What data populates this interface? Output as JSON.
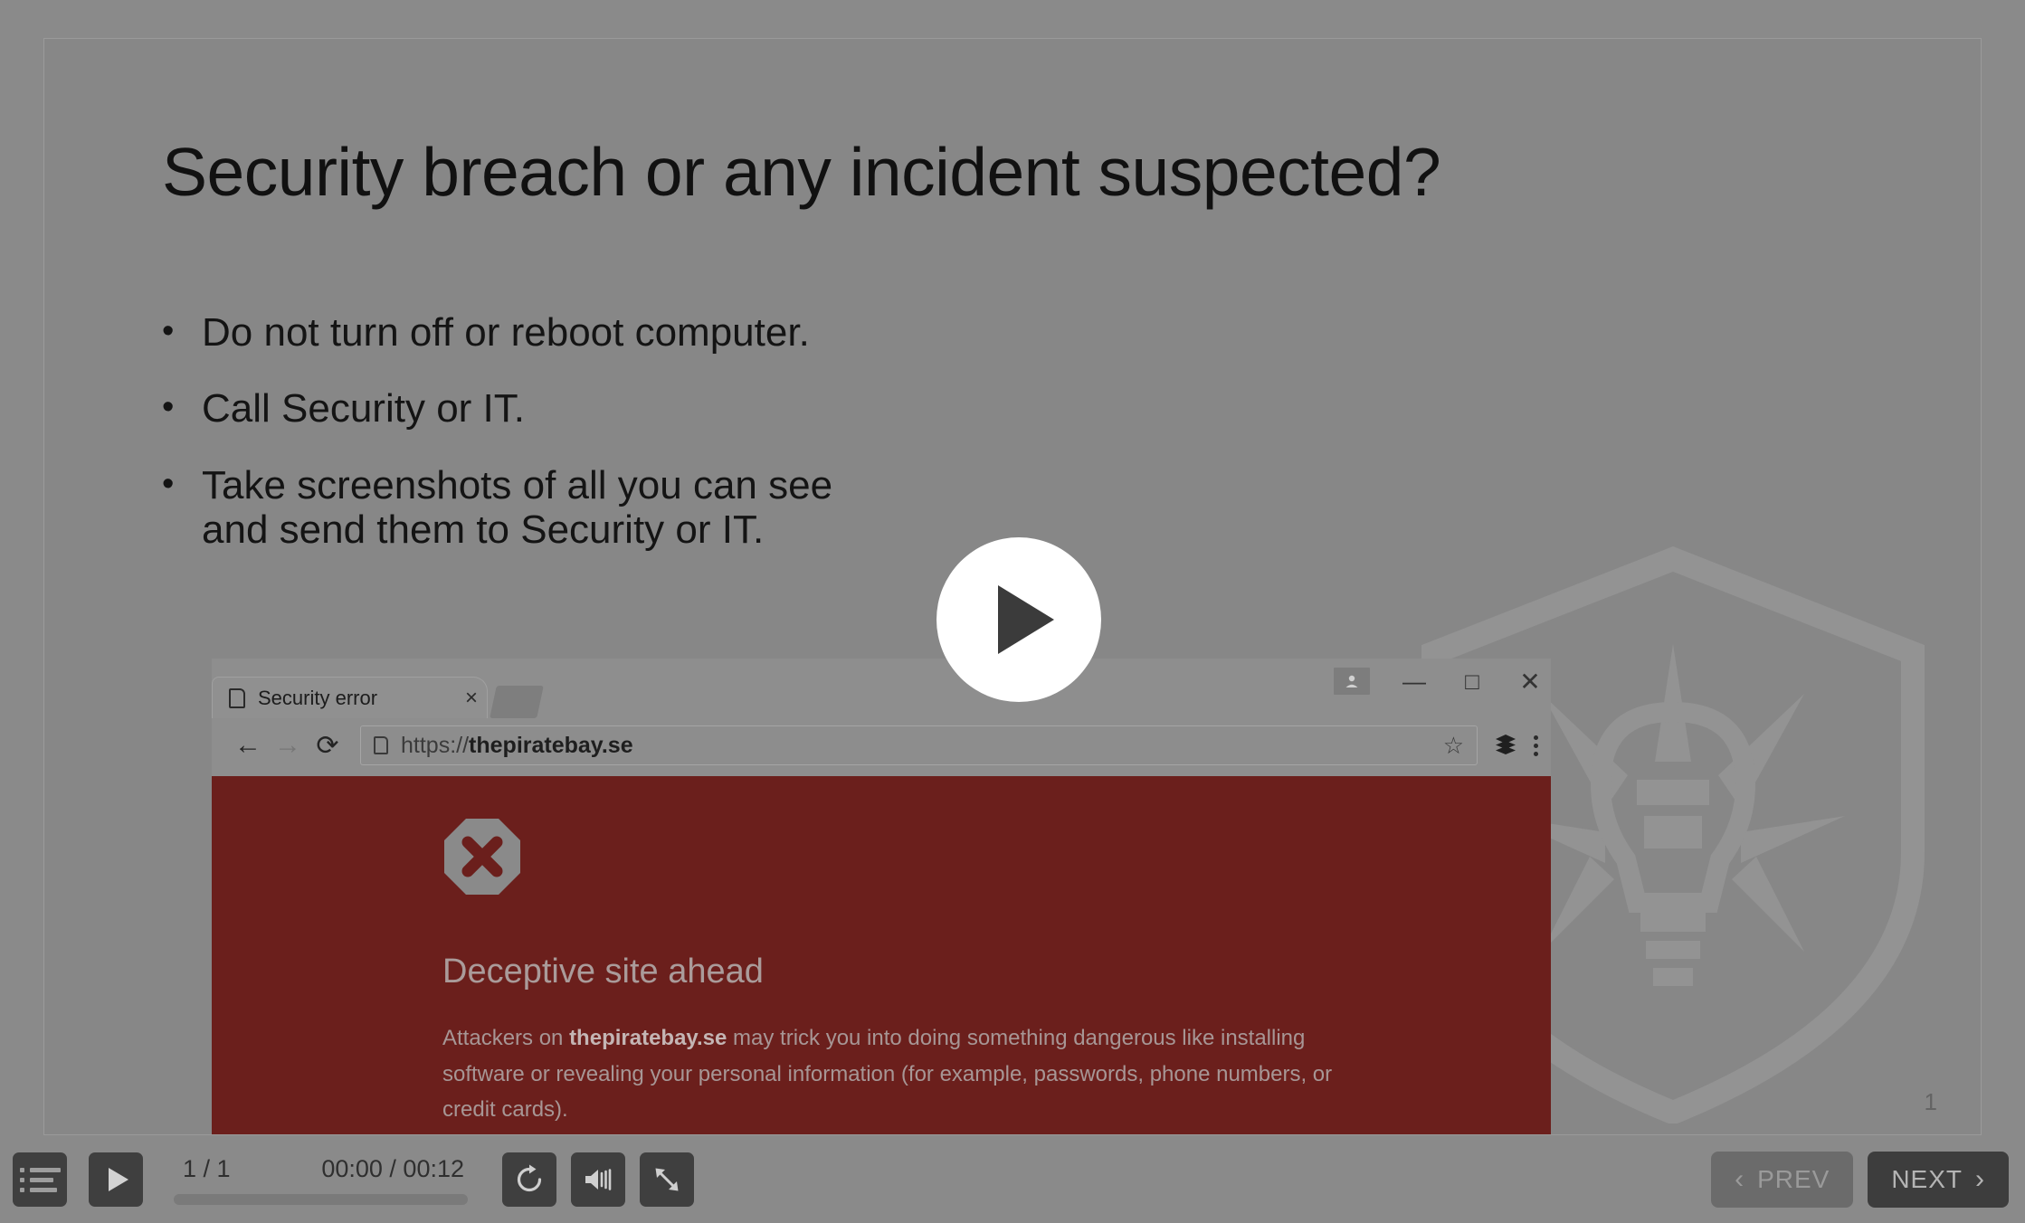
{
  "slide": {
    "title": "Security breach or any incident suspected?",
    "bullets": [
      "Do not turn off or reboot computer.",
      "Call Security or IT.",
      "Take screenshots of all you can see\nand send them to Security or IT."
    ],
    "bullet_marker": "•",
    "slide_number": "1"
  },
  "browser": {
    "tab_title": "Security error",
    "tab_close_label": "×",
    "back_label": "←",
    "forward_label": "→",
    "reload_label": "⟳",
    "url_scheme": "https://",
    "url_host": "thepiratebay.se",
    "star_label": "☆",
    "window_minimize_label": "—",
    "window_maximize_label": "□",
    "window_close_label": "✕",
    "warning": {
      "heading": "Deceptive site ahead",
      "body_lead": "Attackers on ",
      "body_host": "thepiratebay.se",
      "body_rest": " may trick you into doing something dangerous like installing software or revealing your personal information (for example, passwords, phone numbers, or credit cards)."
    }
  },
  "overlay": {
    "play_label": "Play video"
  },
  "controls": {
    "outline_label": "Menu",
    "play_label": "Play",
    "slide_counter": "1 / 1",
    "time": "00:00 / 00:12",
    "progress_percent": 0,
    "replay_label": "Replay",
    "volume_label": "Volume",
    "fullscreen_label": "Fullscreen",
    "prev_label": "PREV",
    "next_label": "NEXT",
    "prev_chevron": "‹",
    "next_chevron": "›"
  },
  "colors": {
    "stage_bg": "#878787",
    "player_bg": "#8a8a8a",
    "warning_red": "#6b1f1c",
    "control_btn": "#3f3f3f",
    "next_btn": "#3d3d3d",
    "prev_btn": "#6b6b6b",
    "slide_text": "#141414"
  }
}
